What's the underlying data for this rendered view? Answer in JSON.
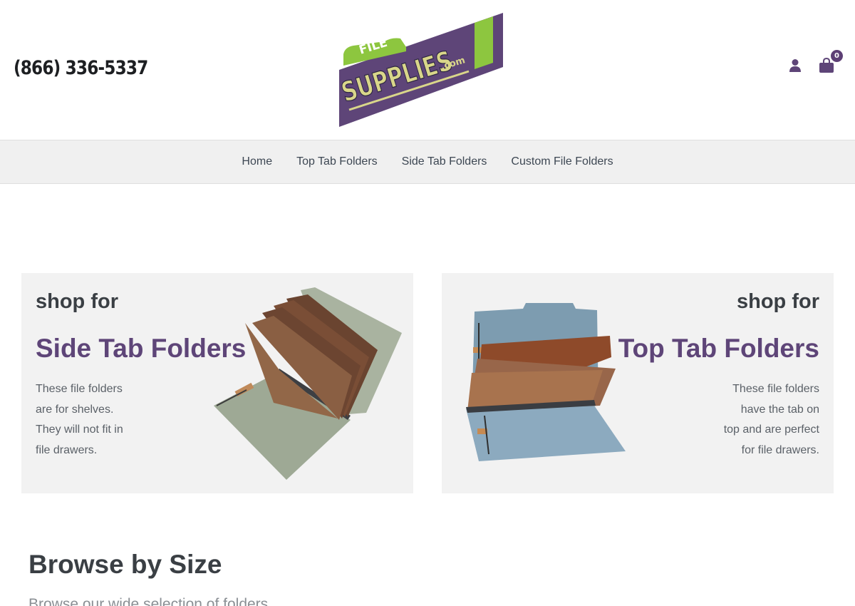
{
  "header": {
    "phone": "(866) 336-5337",
    "logo": {
      "top_text": "FILE",
      "main_text": "SUPPLIES",
      "suffix": ".com"
    },
    "account_icon": "user-icon",
    "cart_icon": "shopping-bag-icon",
    "cart_count": "0"
  },
  "nav": {
    "items": [
      {
        "label": "Home"
      },
      {
        "label": "Top Tab Folders"
      },
      {
        "label": "Side Tab Folders"
      },
      {
        "label": "Custom File Folders"
      }
    ]
  },
  "promos": [
    {
      "pre": "shop for",
      "title": "Side Tab Folders",
      "lines": [
        "These file folders",
        "are for shelves.",
        "They will not fit in",
        "file drawers."
      ]
    },
    {
      "pre": "shop for",
      "title": "Top Tab Folders",
      "lines": [
        "These file folders",
        "have the tab on",
        "top and are perfect",
        "for file drawers."
      ]
    }
  ],
  "browse": {
    "title": "Browse by Size",
    "subtitle": "Browse our wide selection of folders"
  },
  "colors": {
    "brand_purple": "#5e4578",
    "logo_green": "#8dc63f",
    "nav_bg": "#f0f0f0",
    "card_bg": "#f2f2f2"
  }
}
